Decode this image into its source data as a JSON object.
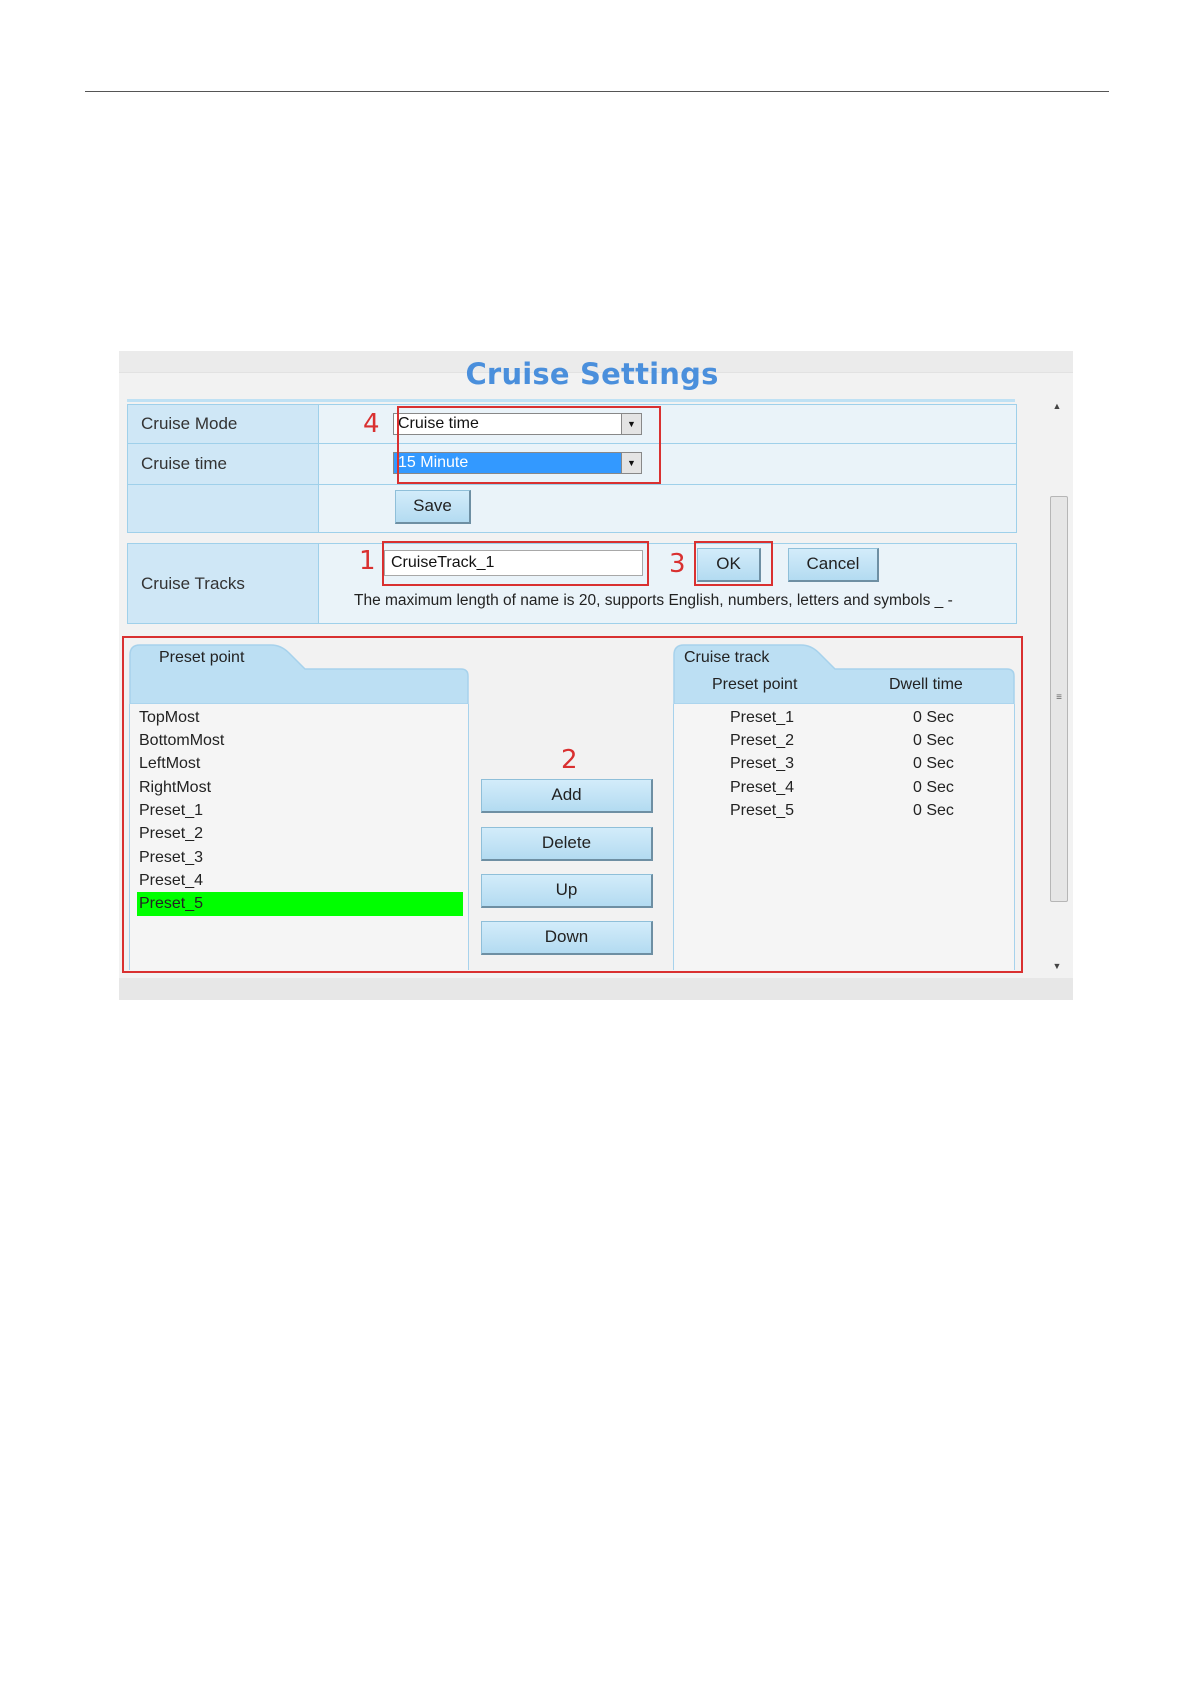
{
  "title": "Cruise Settings",
  "form": {
    "cruise_mode": {
      "label": "Cruise Mode",
      "value": "Cruise time"
    },
    "cruise_time": {
      "label": "Cruise time",
      "value": "15 Minute"
    },
    "save_label": "Save"
  },
  "tracks": {
    "label": "Cruise Tracks",
    "name_value": "CruiseTrack_1",
    "ok_label": "OK",
    "cancel_label": "Cancel",
    "hint": "The maximum length of name is 20, supports English, numbers, letters and symbols _ -"
  },
  "annotations": [
    "1",
    "2",
    "3",
    "4"
  ],
  "preset_panel": {
    "header": "Preset point",
    "items": [
      "TopMost",
      "BottomMost",
      "LeftMost",
      "RightMost",
      "Preset_1",
      "Preset_2",
      "Preset_3",
      "Preset_4",
      "Preset_5"
    ],
    "selected": "Preset_5"
  },
  "actions": {
    "add": "Add",
    "delete": "Delete",
    "up": "Up",
    "down": "Down"
  },
  "cruise_track_panel": {
    "header": "Cruise track",
    "columns": [
      "Preset point",
      "Dwell time"
    ],
    "rows": [
      {
        "preset": "Preset_1",
        "dwell": "0 Sec"
      },
      {
        "preset": "Preset_2",
        "dwell": "0 Sec"
      },
      {
        "preset": "Preset_3",
        "dwell": "0 Sec"
      },
      {
        "preset": "Preset_4",
        "dwell": "0 Sec"
      },
      {
        "preset": "Preset_5",
        "dwell": "0 Sec"
      }
    ]
  },
  "colors": {
    "title": "#4a8fdc",
    "selection_green": "#00ff00",
    "annotation_red": "#d93030",
    "select_highlight": "#3399ff"
  },
  "icons": {
    "dropdown_arrow": "chevron-down-icon",
    "scroll_up": "scroll-up-icon",
    "scroll_down": "scroll-down-icon"
  }
}
